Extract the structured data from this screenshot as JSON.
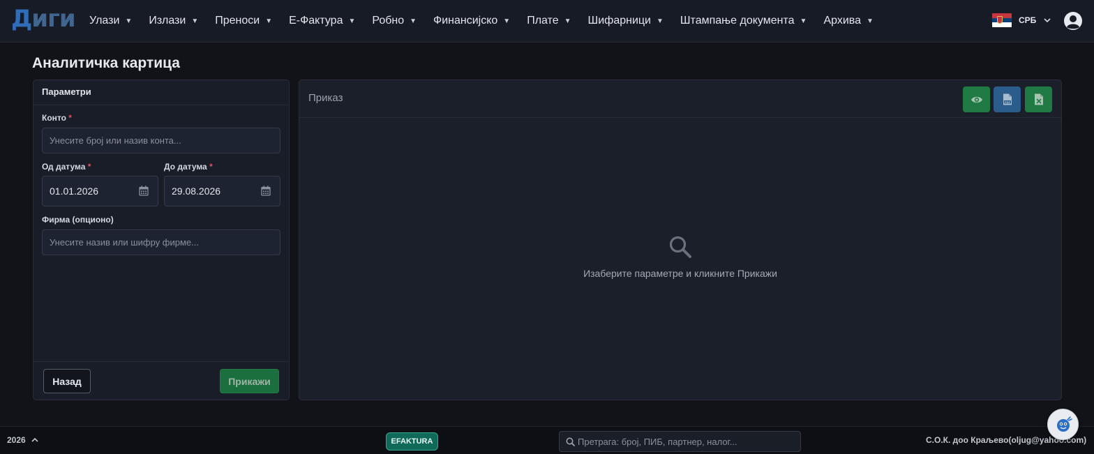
{
  "app": {
    "logo_first": "Д",
    "logo_rest": "иги"
  },
  "nav": {
    "items": [
      {
        "label": "Улази"
      },
      {
        "label": "Излази"
      },
      {
        "label": "Преноси"
      },
      {
        "label": "Е-Фактура"
      },
      {
        "label": "Робно"
      },
      {
        "label": "Финансијско"
      },
      {
        "label": "Плате"
      },
      {
        "label": "Шифарници"
      },
      {
        "label": "Штампање документа"
      },
      {
        "label": "Архива"
      }
    ],
    "caret_icon": "caret-down-icon",
    "language": "СРБ",
    "flag_icon": "serbia-flag-icon",
    "user_icon": "user-circle-icon"
  },
  "page": {
    "title": "Аналитичка картица"
  },
  "params": {
    "header": "Параметри",
    "konto_label": "Конто",
    "konto_placeholder": "Унесите број или назив конта...",
    "from_label": "Од датума",
    "from_value": "01.01.2026",
    "to_label": "До датума",
    "to_value": "29.08.2026",
    "firm_label": "Фирма (опционо)",
    "firm_placeholder": "Унесите назив или шифру фирме...",
    "required_mark": "*",
    "back_button": "Назад",
    "show_button": "Прикажи"
  },
  "view": {
    "title": "Приказ",
    "empty_message": "Изаберите параметре и кликните Прикажи",
    "tools": [
      "eye-icon",
      "pdf-icon",
      "excel-icon"
    ]
  },
  "footer": {
    "year": "2026",
    "efaktura": "EFAKTURA",
    "search_placeholder": "Претрага: број, ПИБ, партнер, налог...",
    "company": "С.О.К. доо Краљево(oljug@yahoo.com)"
  },
  "colors": {
    "background": "#111318",
    "navbar": "#171b25",
    "panel": "#191d27",
    "success": "#1f7a44",
    "primary": "#2a5c8c",
    "logo": "#2f6db8",
    "efaktura": "#0f6a5a",
    "required": "#e05260"
  }
}
